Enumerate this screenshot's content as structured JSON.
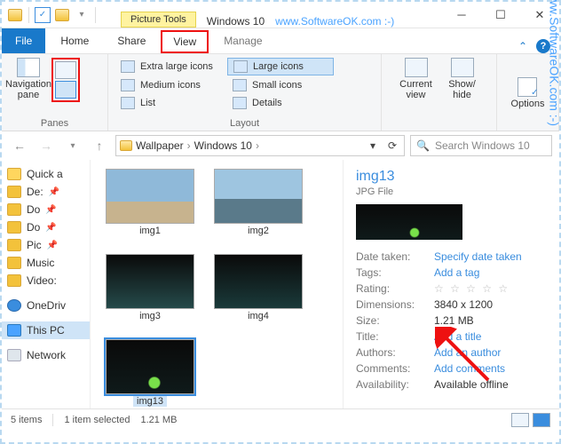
{
  "window": {
    "contextual_tab_label": "Picture Tools",
    "title": "Windows 10",
    "watermark_top": "www.SoftwareOK.com :-)",
    "watermark_side": "www.SoftwareOK.com :-)"
  },
  "tabs": {
    "file": "File",
    "home": "Home",
    "share": "Share",
    "view": "View",
    "manage": "Manage"
  },
  "ribbon": {
    "panes": {
      "navpane": "Navigation\npane",
      "group_label": "Panes"
    },
    "layout": {
      "extra_large": "Extra large icons",
      "large": "Large icons",
      "medium": "Medium icons",
      "small": "Small icons",
      "list": "List",
      "details": "Details",
      "group_label": "Layout"
    },
    "current_view": {
      "current": "Current\nview",
      "showhide": "Show/\nhide"
    },
    "options": "Options"
  },
  "address": {
    "crumbs": [
      "Wallpaper",
      "Windows 10"
    ],
    "search_placeholder": "Search Windows 10"
  },
  "sidebar": {
    "items": [
      {
        "label": "Quick a"
      },
      {
        "label": "De:",
        "pin": true
      },
      {
        "label": "Do",
        "pin": true
      },
      {
        "label": "Do",
        "pin": true
      },
      {
        "label": "Pic",
        "pin": true
      },
      {
        "label": "Music"
      },
      {
        "label": "Video:"
      },
      {
        "label": "OneDriv"
      },
      {
        "label": "This PC"
      },
      {
        "label": "Network"
      }
    ]
  },
  "thumbs": [
    {
      "label": "img1"
    },
    {
      "label": "img2"
    },
    {
      "label": "img3"
    },
    {
      "label": "img4"
    },
    {
      "label": "img13",
      "selected": true
    }
  ],
  "details": {
    "title": "img13",
    "type": "JPG File",
    "rows": [
      {
        "key": "Date taken:",
        "val": "Specify date taken",
        "link": true
      },
      {
        "key": "Tags:",
        "val": "Add a tag",
        "link": true
      },
      {
        "key": "Rating:",
        "stars": true
      },
      {
        "key": "Dimensions:",
        "val": "3840 x 1200"
      },
      {
        "key": "Size:",
        "val": "1.21 MB"
      },
      {
        "key": "Title:",
        "val": "Add a title",
        "link": true
      },
      {
        "key": "Authors:",
        "val": "Add an author",
        "link": true
      },
      {
        "key": "Comments:",
        "val": "Add comments",
        "link": true
      },
      {
        "key": "Availability:",
        "val": "Available offline"
      }
    ]
  },
  "status": {
    "count": "5 items",
    "selection": "1 item selected",
    "size": "1.21 MB"
  }
}
